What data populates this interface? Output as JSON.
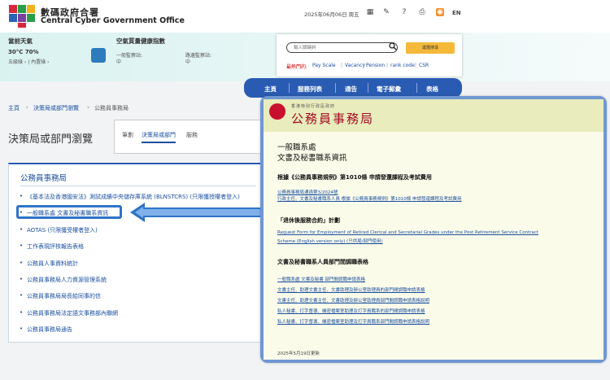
{
  "header": {
    "site_title_zh": "數碼政府合署",
    "site_title_en": "Central Cyber Government Office",
    "date": "2025年06月06日 周五",
    "toolbar_icons": [
      "contacts-icon",
      "feedback-icon",
      "help-icon",
      "print-icon",
      "rss-icon"
    ],
    "language": "EN"
  },
  "weather": {
    "title": "當前天氣",
    "value": "30°C  70%",
    "links": "五級綠 ›  |  內置綠 ›"
  },
  "air_quality": {
    "title": "空氣質量健康指數",
    "general_label": "一般監察站:",
    "general_value": "中",
    "roadside_label": "路邊監察站:",
    "roadside_value": "中"
  },
  "search": {
    "placeholder": "輸入關鍵詞",
    "advanced_label": "進階搜尋",
    "popular_label": "最熱門的:",
    "popular": [
      "Pay Scale",
      "Vacancy",
      "Pension",
      "rank code",
      "CSR"
    ]
  },
  "nav": [
    "主頁",
    "服務列表",
    "通告",
    "電子郵彙",
    "表格"
  ],
  "breadcrumb": [
    "主頁",
    "決策局或部門瀏覽",
    "公務員事務局"
  ],
  "page_title": "決策局或部門瀏覽",
  "filters": [
    "筆劃",
    "決策局或部門",
    "服務"
  ],
  "panel": {
    "title": "公務員事務局",
    "items": [
      "《基本法及香港國安法》測試成績中央儲存庫系統 (BLNSTCRS) (只限獲授權者登入)",
      "一般職系處 文書及秘書職系資訊",
      "AOTAS (只限獲受權者登入)",
      "工作表現評核報告表格",
      "公務員人事資料統計",
      "公務員事務局人力資源管理系統",
      "公務員事務局局長給同事的信",
      "公務員事務局法定語文事務部內聯網",
      "公務員事務局通告"
    ]
  },
  "popup": {
    "small_title": "香港特別行政區政府",
    "big_title": "公務員事務局",
    "heading1": "一般職系處",
    "heading2": "文書及秘書職系資訊",
    "section1": "根據《公務員事務規例》第1010條 申請發還課程及考試費用",
    "section1_links": [
      "公務員事務局通函第3/2024號",
      "行政主任、文書及秘書職系人員 根據《公務員事務規例》第1010條 申請發還課程及考試費用"
    ],
    "section2": "「退休後服務合約」計劃",
    "section2_links": [
      "Request Form for Employment of Retired Clerical and Secretarial Grades under the Post Retirement Service Contract",
      "Scheme (English version only) (只供局/部門使用)"
    ],
    "section3": "文書及秘書職系人員部門間調職表格",
    "section3_links": [
      "一般職系處 文書及秘書 部門間調職申請表格",
      "文書主任、助理文書主任、文書助理及辦公室助理員的部門間調職申請表格",
      "文書主任、助理文書主任、文書助理及辦公室助理員部門間調職申請表格說明",
      "私人秘書、打字督導、機密檔案室助理及打字員職系的部門間調職申請表格",
      "私人秘書、打字督導、機密檔案室助理及打字員職系部門間調職申請表格說明"
    ],
    "updated": "2025年5月19日更新"
  }
}
